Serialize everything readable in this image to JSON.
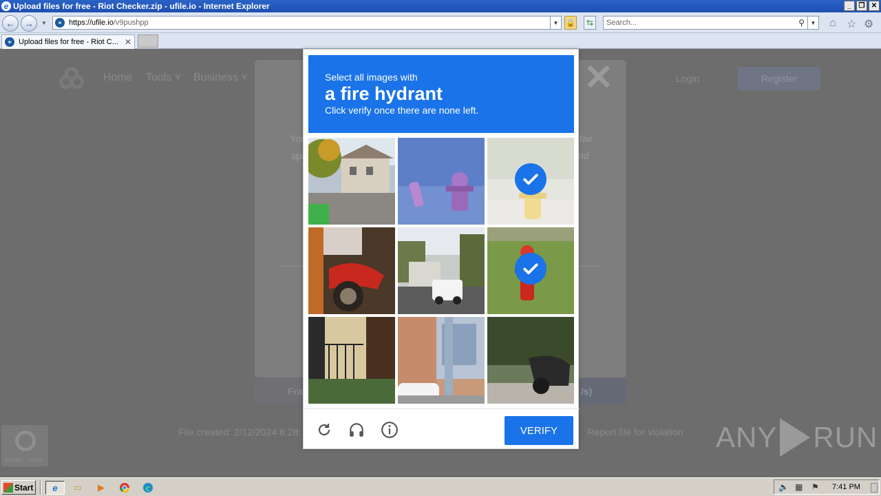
{
  "window": {
    "title": "Upload files for free - Riot Checker.zip - ufile.io - Internet Explorer"
  },
  "address": {
    "host": "https://ufile.io",
    "path": "/v9pushpp"
  },
  "search": {
    "placeholder": "Search..."
  },
  "tab": {
    "label": "Upload files for free - Riot C..."
  },
  "site": {
    "nav": [
      "Home",
      "Tools",
      "Business"
    ],
    "login": "Login",
    "register": "Register",
    "modal_text_1_left": "You",
    "modal_text_1_right": "fair",
    "modal_text_2_left": "spe",
    "modal_text_2_right": "nd",
    "free_label": "Fra",
    "fast_label": "/s)",
    "file_created": "File created: 2/12/2024 6:28:",
    "report_sep": "|",
    "report": "Report file for violation",
    "recaptcha_terms": "Privacy - Terms"
  },
  "captcha": {
    "prompt_line1": "Select all images with",
    "prompt_line2": "a fire hydrant",
    "prompt_line3": "Click verify once there are none left.",
    "verify_label": "VERIFY",
    "tiles": [
      {
        "content": "residential street with houses",
        "selected": false
      },
      {
        "content": "purple fire hydrant",
        "selected": false
      },
      {
        "content": "yellow fire hydrant",
        "selected": true
      },
      {
        "content": "red motorcycle",
        "selected": false
      },
      {
        "content": "truck on road",
        "selected": false
      },
      {
        "content": "red fire hydrant on grass",
        "selected": true
      },
      {
        "content": "building with railing",
        "selected": false
      },
      {
        "content": "pole and parked car",
        "selected": false
      },
      {
        "content": "parked scooter",
        "selected": false
      }
    ],
    "accent_color": "#1a73e8"
  },
  "watermark": {
    "left": "ANY",
    "right": "RUN"
  },
  "taskbar": {
    "start_label": "Start",
    "clock": "7:41 PM"
  }
}
